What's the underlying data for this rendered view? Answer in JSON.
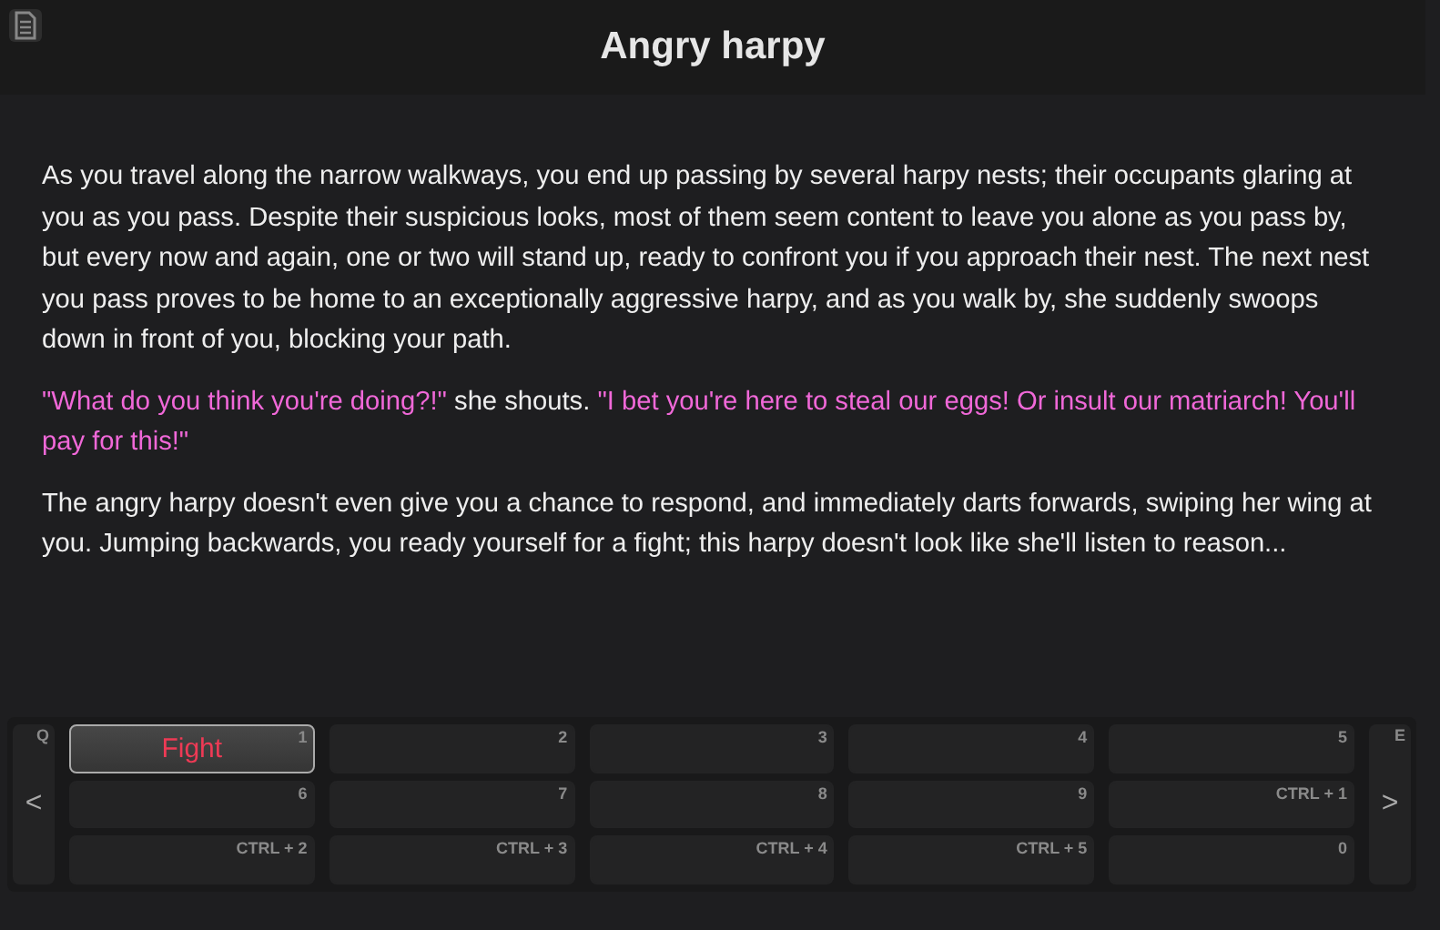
{
  "header": {
    "title": "Angry harpy"
  },
  "paragraphs": [
    {
      "segments": [
        {
          "kind": "narration",
          "text": "As you travel along the narrow walkways, you end up passing by several harpy nests; their occupants glaring at you as you pass. Despite their suspicious looks, most of them seem content to leave you alone as you pass by, but every now and again, one or two will stand up, ready to confront you if you approach their nest. The next nest you pass proves to be home to an exceptionally aggressive harpy, and as you walk by, she suddenly swoops down in front of you, blocking your path."
        }
      ]
    },
    {
      "segments": [
        {
          "kind": "speech",
          "text": "\"What do you think you're doing?!\""
        },
        {
          "kind": "narration",
          "text": " she shouts. "
        },
        {
          "kind": "speech",
          "text": "\"I bet you're here to steal our eggs! Or insult our matriarch! You'll pay for this!\""
        }
      ]
    },
    {
      "segments": [
        {
          "kind": "narration",
          "text": "The angry harpy doesn't even give you a chance to respond, and immediately darts forwards, swiping her wing at you. Jumping backwards, you ready yourself for a fight; this harpy doesn't look like she'll listen to reason..."
        }
      ]
    }
  ],
  "actions": {
    "prev": {
      "label": "<",
      "hotkey": "Q"
    },
    "next": {
      "label": ">",
      "hotkey": "E"
    },
    "slots": [
      {
        "label": "Fight",
        "hotkey": "1",
        "active": true
      },
      {
        "hotkey": "2",
        "active": false
      },
      {
        "hotkey": "3",
        "active": false
      },
      {
        "hotkey": "4",
        "active": false
      },
      {
        "hotkey": "5",
        "active": false
      },
      {
        "hotkey": "6",
        "active": false
      },
      {
        "hotkey": "7",
        "active": false
      },
      {
        "hotkey": "8",
        "active": false
      },
      {
        "hotkey": "9",
        "active": false
      },
      {
        "hotkey": "CTRL + 1",
        "active": false
      },
      {
        "hotkey": "CTRL + 2",
        "active": false
      },
      {
        "hotkey": "CTRL + 3",
        "active": false
      },
      {
        "hotkey": "CTRL + 4",
        "active": false
      },
      {
        "hotkey": "CTRL + 5",
        "active": false
      },
      {
        "hotkey": "0",
        "active": false
      }
    ]
  }
}
